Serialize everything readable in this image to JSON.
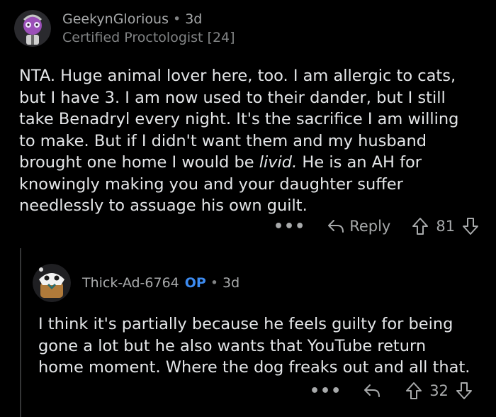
{
  "comments": [
    {
      "username": "GeekynGlorious",
      "separator": "•",
      "age": "3d",
      "flair": "Certified Proctologist [24]",
      "body_lines": [
        "NTA. Huge animal lover here, too. I am allergic to cats,",
        "but I have 3. I am now used to their dander, but I still",
        "take Benadryl every night. It's the sacrifice I am willing",
        "to make. But if I didn't want them and my husband",
        "brought one home I would be ",
        "livid.",
        " He is an AH for",
        "knowingly making you and your daughter suffer",
        "needlessly to assuage his own guilt."
      ],
      "more_label": "•••",
      "reply_label": "Reply",
      "score": "81",
      "icons": [
        "avatar",
        "more-icon",
        "reply-arrow-icon",
        "upvote-icon",
        "downvote-icon"
      ]
    },
    {
      "username": "Thick-Ad-6764",
      "badge": "OP",
      "separator": "•",
      "age": "3d",
      "body_lines": [
        "I think it's partially because he feels guilty for being",
        "gone a lot but he also wants that YouTube return",
        "home moment. Where the dog freaks out and all that."
      ],
      "more_label": "•••",
      "score": "32",
      "icons": [
        "avatar",
        "more-icon",
        "reply-arrow-icon",
        "upvote-icon",
        "downvote-icon"
      ]
    }
  ],
  "colors": {
    "background": "#000000",
    "text": "#e4e6e8",
    "muted": "#a8aaab",
    "op_badge": "#3d8bf0",
    "thread_line": "#343536"
  }
}
